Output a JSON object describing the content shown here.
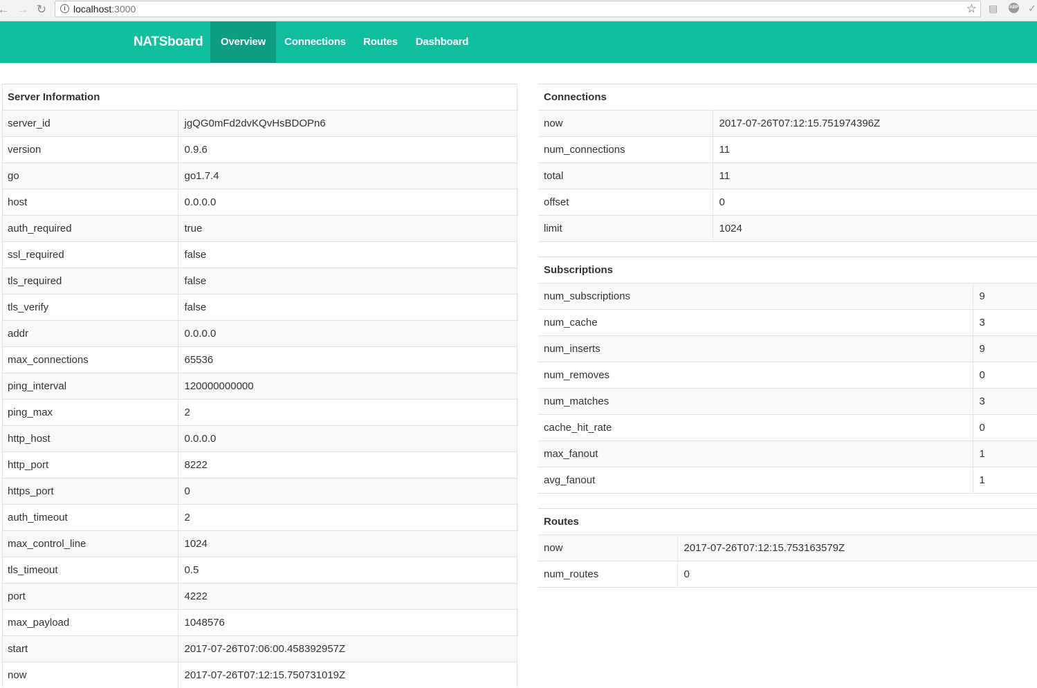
{
  "browser": {
    "url_host": "localhost",
    "url_port": ":3000"
  },
  "navbar": {
    "brand": "NATSboard",
    "items": [
      {
        "label": "Overview",
        "active": true
      },
      {
        "label": "Connections",
        "active": false
      },
      {
        "label": "Routes",
        "active": false
      },
      {
        "label": "Dashboard",
        "active": false
      }
    ],
    "color": "#10bf9f",
    "active_color": "#0d9e84"
  },
  "server_info": {
    "title": "Server Information",
    "rows": [
      {
        "key": "server_id",
        "value": "jgQG0mFd2dvKQvHsBDOPn6"
      },
      {
        "key": "version",
        "value": "0.9.6"
      },
      {
        "key": "go",
        "value": "go1.7.4"
      },
      {
        "key": "host",
        "value": "0.0.0.0"
      },
      {
        "key": "auth_required",
        "value": "true"
      },
      {
        "key": "ssl_required",
        "value": "false"
      },
      {
        "key": "tls_required",
        "value": "false"
      },
      {
        "key": "tls_verify",
        "value": "false"
      },
      {
        "key": "addr",
        "value": "0.0.0.0"
      },
      {
        "key": "max_connections",
        "value": "65536"
      },
      {
        "key": "ping_interval",
        "value": "120000000000"
      },
      {
        "key": "ping_max",
        "value": "2"
      },
      {
        "key": "http_host",
        "value": "0.0.0.0"
      },
      {
        "key": "http_port",
        "value": "8222"
      },
      {
        "key": "https_port",
        "value": "0"
      },
      {
        "key": "auth_timeout",
        "value": "2"
      },
      {
        "key": "max_control_line",
        "value": "1024"
      },
      {
        "key": "tls_timeout",
        "value": "0.5"
      },
      {
        "key": "port",
        "value": "4222"
      },
      {
        "key": "max_payload",
        "value": "1048576"
      },
      {
        "key": "start",
        "value": "2017-07-26T07:06:00.458392957Z"
      },
      {
        "key": "now",
        "value": "2017-07-26T07:12:15.750731019Z"
      }
    ]
  },
  "connections": {
    "title": "Connections",
    "rows": [
      {
        "key": "now",
        "value": "2017-07-26T07:12:15.751974396Z"
      },
      {
        "key": "num_connections",
        "value": "11"
      },
      {
        "key": "total",
        "value": "11"
      },
      {
        "key": "offset",
        "value": "0"
      },
      {
        "key": "limit",
        "value": "1024"
      }
    ]
  },
  "subscriptions": {
    "title": "Subscriptions",
    "rows": [
      {
        "key": "num_subscriptions",
        "value": "9"
      },
      {
        "key": "num_cache",
        "value": "3"
      },
      {
        "key": "num_inserts",
        "value": "9"
      },
      {
        "key": "num_removes",
        "value": "0"
      },
      {
        "key": "num_matches",
        "value": "3"
      },
      {
        "key": "cache_hit_rate",
        "value": "0"
      },
      {
        "key": "max_fanout",
        "value": "1"
      },
      {
        "key": "avg_fanout",
        "value": "1"
      }
    ]
  },
  "routes": {
    "title": "Routes",
    "rows": [
      {
        "key": "now",
        "value": "2017-07-26T07:12:15.753163579Z"
      },
      {
        "key": "num_routes",
        "value": "0"
      }
    ]
  }
}
